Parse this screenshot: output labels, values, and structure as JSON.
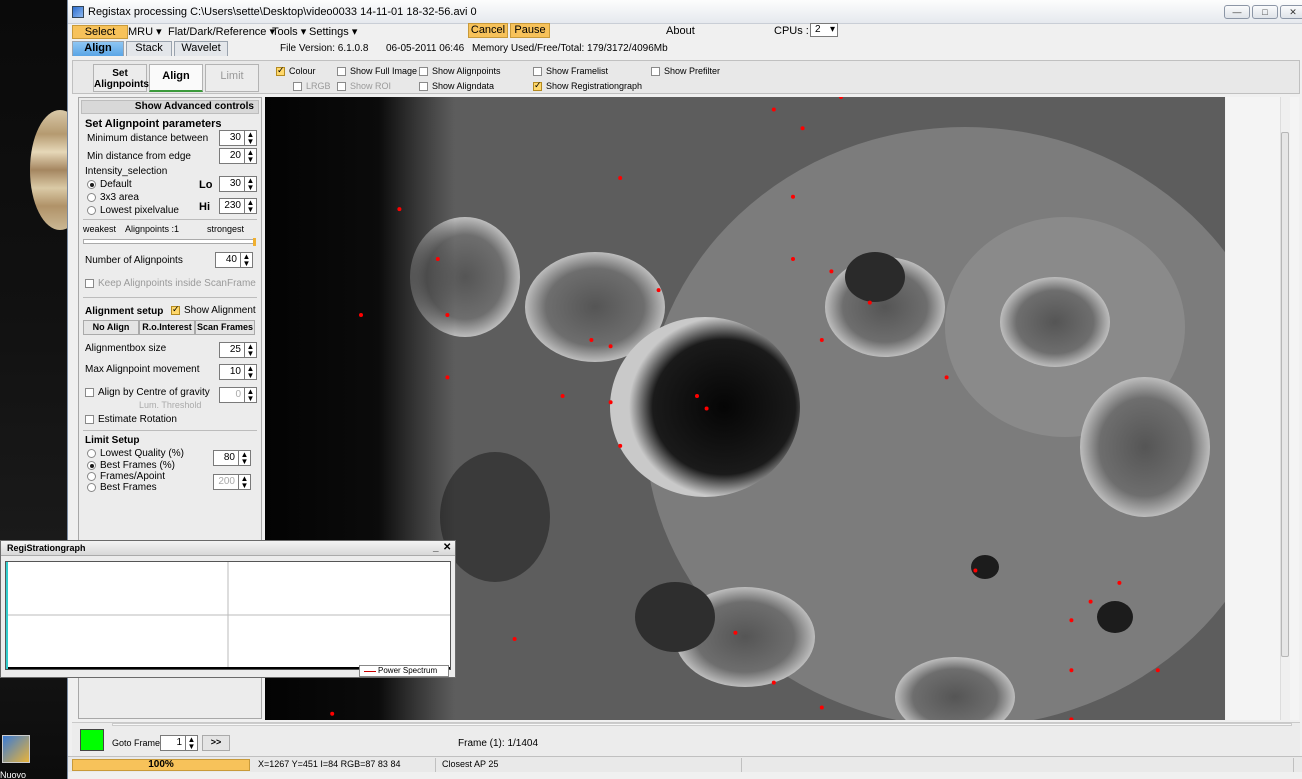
{
  "desktop": {
    "icon_label": "Nuovo"
  },
  "titlebar": {
    "title": "Registax processing C:\\Users\\sette\\Desktop\\video0033 14-11-01 18-32-56.avi 0"
  },
  "menubar": {
    "select": "Select",
    "mru": "MRU",
    "flat": "Flat/Dark/Reference",
    "tools": "Tools",
    "settings": "Settings",
    "cancel": "Cancel",
    "pause": "Pause",
    "about": "About",
    "cpus_label": "CPUs :",
    "cpus_value": "2"
  },
  "tabs": {
    "align": "Align",
    "stack": "Stack",
    "wavelet": "Wavelet"
  },
  "fileinfo": {
    "version": "File Version: 6.1.0.8",
    "date": "06-05-2011 06:46",
    "memory": "Memory Used/Free/Total: 179/3172/4096Mb"
  },
  "subtabs": {
    "set_alignpoints": "Set Alignpoints",
    "align": "Align",
    "limit": "Limit"
  },
  "options": {
    "colour": "Colour",
    "lrgb": "LRGB",
    "show_full_image": "Show Full Image",
    "show_roi": "Show ROI",
    "show_alignpoints": "Show Alignpoints",
    "show_aligndata": "Show Aligndata",
    "show_framelist": "Show Framelist",
    "show_registrationgraph": "Show Registrationgraph",
    "show_prefilter": "Show Prefilter"
  },
  "panel": {
    "advanced": "Show Advanced controls",
    "set_params_head": "Set Alignpoint parameters",
    "min_dist_label": "Minimum distance between",
    "min_dist_value": "30",
    "min_edge_label": "Min distance from edge",
    "min_edge_value": "20",
    "intensity_head": "Intensity_selection",
    "default": "Default",
    "area3x3": "3x3 area",
    "lowest": "Lowest pixelvalue",
    "lo_label": "Lo",
    "lo_value": "30",
    "hi_label": "Hi",
    "hi_value": "230",
    "weakest": "weakest",
    "alignpoints_count": "Alignpoints :1",
    "strongest": "strongest",
    "num_ap_label": "Number of Alignpoints",
    "num_ap_value": "40",
    "keep_inside": "Keep Alignpoints inside ScanFrame",
    "align_setup_head": "Alignment setup",
    "show_alignment": "Show Alignment",
    "no_align": "No Align",
    "ro_interest": "R.o.Interest",
    "scan_frames": "Scan Frames",
    "box_size_label": "Alignmentbox size",
    "box_size_value": "25",
    "max_move_label": "Max Alignpoint movement",
    "max_move_value": "10",
    "centre_gravity": "Align by Centre of gravity",
    "centre_value": "0",
    "lum_threshold": "Lum. Threshold",
    "estimate_rotation": "Estimate Rotation",
    "limit_head": "Limit Setup",
    "lowest_quality": "Lowest Quality (%)",
    "best_frames_pct": "Best Frames (%)",
    "best_value": "80",
    "frames_apoint": "Frames/Apoint",
    "best_frames": "Best Frames",
    "frames_value": "200"
  },
  "graph": {
    "title": "RegiStrationgraph",
    "minimize": "_",
    "close": "✕",
    "legend": "Power Spectrum"
  },
  "bottom": {
    "goto_label": "Goto Frame",
    "goto_value": "1",
    "goto_btn": ">>",
    "frame_info": "Frame (1): 1/1404"
  },
  "status": {
    "progress": "100%",
    "pixel": "X=1267 Y=451 I=84 RGB=87 83 84",
    "closest": "Closest AP 25"
  },
  "colors": {
    "accent_orange": "#f7c25a",
    "active_tab_blue": "#5aa5e6",
    "alignpoint_red": "#ff0000",
    "frame_green": "#00ff00"
  },
  "alignpoints": [
    [
      0.53,
      0.02
    ],
    [
      0.6,
      0.0
    ],
    [
      0.37,
      0.13
    ],
    [
      0.41,
      0.31
    ],
    [
      0.34,
      0.39
    ],
    [
      0.36,
      0.4
    ],
    [
      0.14,
      0.18
    ],
    [
      0.18,
      0.26
    ],
    [
      0.1,
      0.35
    ],
    [
      0.19,
      0.35
    ],
    [
      0.19,
      0.45
    ],
    [
      0.31,
      0.48
    ],
    [
      0.36,
      0.49
    ],
    [
      0.45,
      0.48
    ],
    [
      0.46,
      0.5
    ],
    [
      0.37,
      0.56
    ],
    [
      0.56,
      0.05
    ],
    [
      0.55,
      0.16
    ],
    [
      0.55,
      0.26
    ],
    [
      0.59,
      0.28
    ],
    [
      0.63,
      0.33
    ],
    [
      0.58,
      0.39
    ],
    [
      0.71,
      0.45
    ],
    [
      0.74,
      0.76
    ],
    [
      0.89,
      0.78
    ],
    [
      0.86,
      0.81
    ],
    [
      0.84,
      0.84
    ],
    [
      0.49,
      0.86
    ],
    [
      0.26,
      0.87
    ],
    [
      0.53,
      0.94
    ],
    [
      0.58,
      0.98
    ],
    [
      0.84,
      0.92
    ],
    [
      0.93,
      0.92
    ],
    [
      0.84,
      0.999
    ],
    [
      0.07,
      0.99
    ]
  ]
}
